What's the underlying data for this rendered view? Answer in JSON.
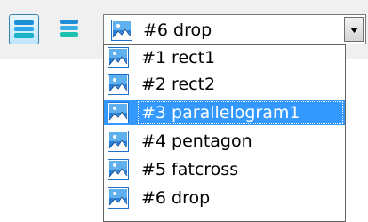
{
  "toolbar": {
    "buttons": [
      {
        "icon": "layers-icon",
        "pressed": true
      },
      {
        "icon": "layers-stack-icon",
        "pressed": false
      }
    ]
  },
  "combo": {
    "icon": "image-icon",
    "selected_label": "#6 drop"
  },
  "dropdown": {
    "items": [
      {
        "label": "#1 rect1",
        "icon": "image-icon",
        "highlighted": false
      },
      {
        "label": "#2 rect2",
        "icon": "image-icon",
        "highlighted": false
      },
      {
        "label": "#3 parallelogram1",
        "icon": "image-icon",
        "highlighted": true
      },
      {
        "label": "#4 pentagon",
        "icon": "image-icon",
        "highlighted": false
      },
      {
        "label": "#5 fatcross",
        "icon": "image-icon",
        "highlighted": false
      },
      {
        "label": "#6 drop",
        "icon": "image-icon",
        "highlighted": false
      }
    ]
  },
  "colors": {
    "highlight": "#3399ff",
    "icon_blue": "#1e6fc8",
    "toolbar_bg": "#f0f0f0"
  }
}
